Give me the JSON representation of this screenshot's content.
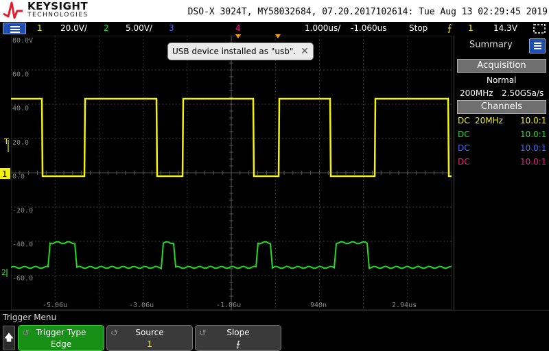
{
  "header": {
    "brand": "KEYSIGHT",
    "brand_sub": "TECHNOLOGIES",
    "info": "DSO-X 3024T, MY58032684, 07.20.2017102614: Tue Aug 13 02:29:45 2019"
  },
  "status_bar": {
    "ch1_num": "1",
    "ch1_scale": "20.0V/",
    "ch2_num": "2",
    "ch2_scale": "5.00V/",
    "ch3_num": "3",
    "ch4_num": "4",
    "timebase": "1.000us/",
    "delay": "-1.060us",
    "run_state": "Stop",
    "trig_slope": "⨍",
    "trig_source": "1",
    "trig_level": "14.3V"
  },
  "graticule": {
    "v_labels": [
      "80.0V",
      "60.0",
      "40.0",
      "20.0",
      "0.0",
      "-20.0",
      "-40.0",
      "-60.0"
    ],
    "t_labels": [
      "-5.06u",
      "-3.06u",
      "-1.06u",
      "940n",
      "2.94us"
    ]
  },
  "markers": {
    "trig_level": "T",
    "ch1": "1",
    "ch2": "2"
  },
  "notice": {
    "text": "USB device installed as \"usb\".",
    "close": "✕"
  },
  "side_panel": {
    "tab": "Summary",
    "acquisition": {
      "title": "Acquisition",
      "mode": "Normal",
      "bw": "200MHz",
      "rate": "2.50GSa/s"
    },
    "channels": {
      "title": "Channels",
      "rows": [
        {
          "coupling": "DC",
          "limit": "20MHz",
          "probe": "10.0:1",
          "color": "#f4f20a"
        },
        {
          "coupling": "DC",
          "limit": "",
          "probe": "10.0:1",
          "color": "#22dd22"
        },
        {
          "coupling": "DC",
          "limit": "",
          "probe": "10.0:1",
          "color": "#4466ff"
        },
        {
          "coupling": "DC",
          "limit": "",
          "probe": "10.0:1",
          "color": "#ee2288"
        }
      ]
    }
  },
  "trigger_menu": {
    "title": "Trigger Menu",
    "up_icon": "🡅",
    "softkeys": [
      {
        "label": "Trigger Type",
        "value": "Edge"
      },
      {
        "label": "Source",
        "value": "1"
      },
      {
        "label": "Slope",
        "value": "⨍"
      }
    ]
  },
  "colors": {
    "ch1": "#f4f20a",
    "ch2": "#22dd22",
    "ch3": "#4466ff",
    "ch4": "#ee2288",
    "accent": "#1f4fb0"
  }
}
